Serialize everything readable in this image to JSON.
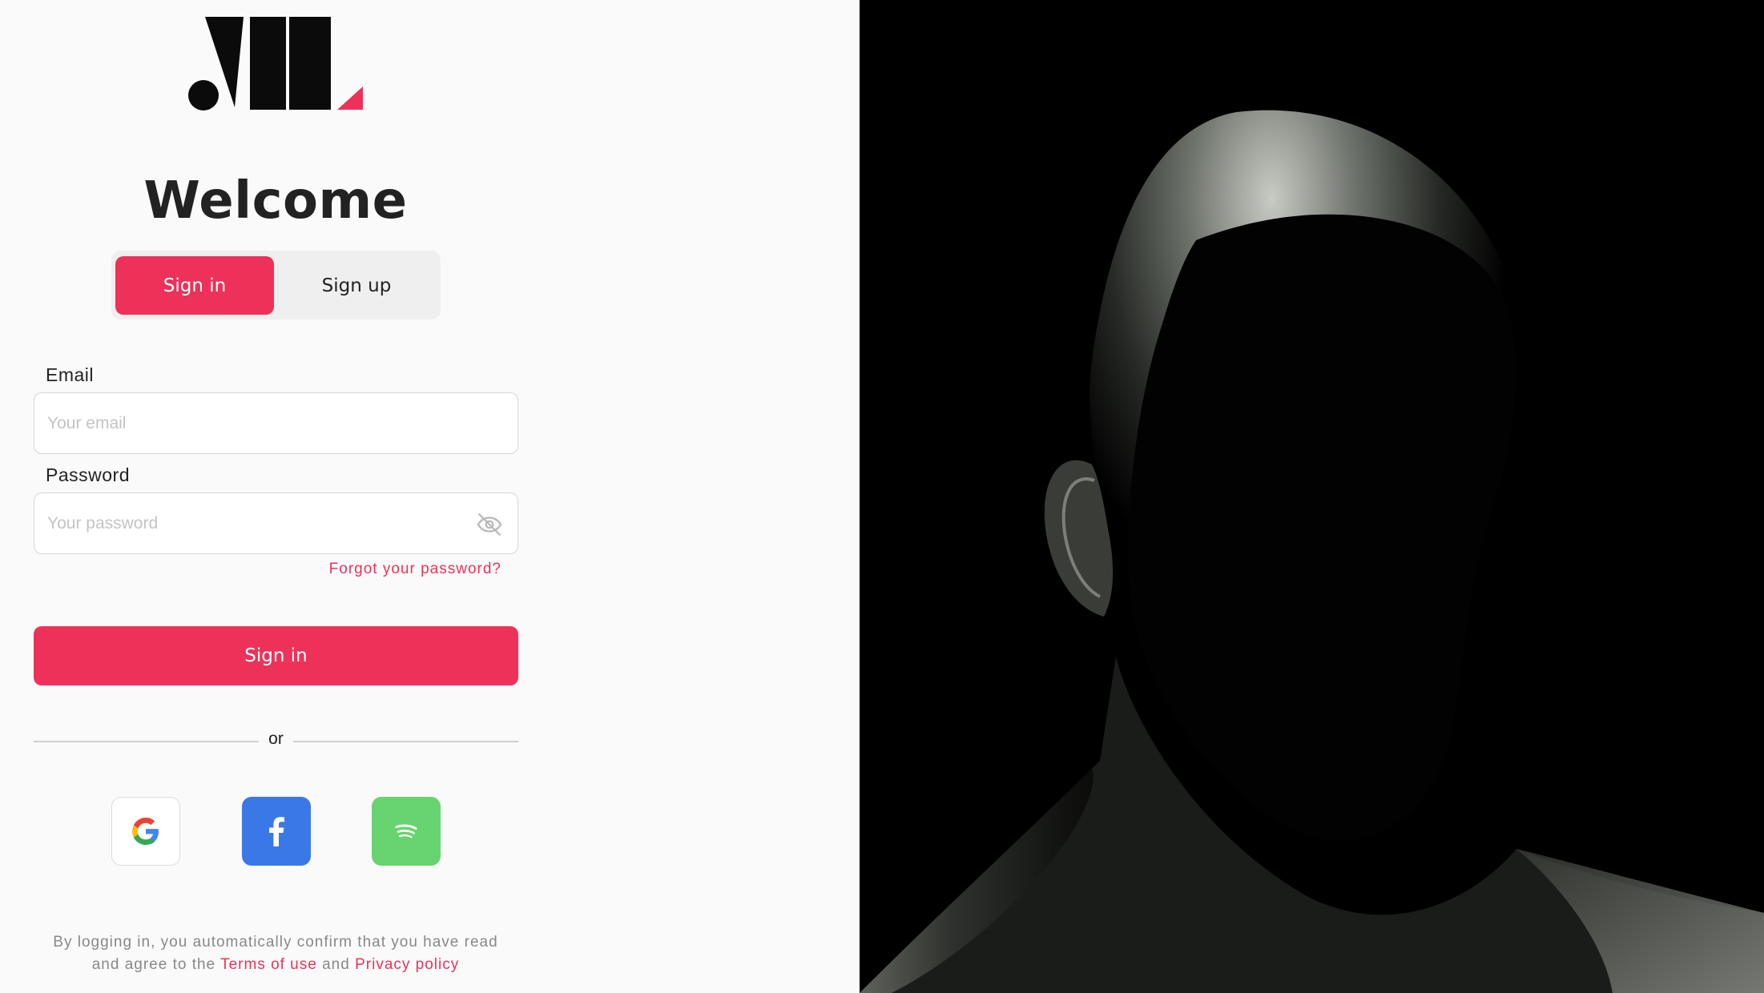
{
  "colors": {
    "accent": "#ee3158",
    "facebook": "#3b78e7",
    "spotify": "#67d46f",
    "hero_background": "#000000"
  },
  "brand": {
    "logo_icon": "ml-logo-icon"
  },
  "heading": "Welcome",
  "tabs": [
    {
      "label": "Sign in",
      "active": true
    },
    {
      "label": "Sign up",
      "active": false
    }
  ],
  "form": {
    "email": {
      "label": "Email",
      "placeholder": "Your email",
      "value": ""
    },
    "password": {
      "label": "Password",
      "placeholder": "Your password",
      "value": "",
      "toggle_icon": "eye-off-icon"
    },
    "forgot_label": "Forgot your password?",
    "submit_label": "Sign in"
  },
  "divider_label": "or",
  "social": [
    {
      "icon": "google-icon"
    },
    {
      "icon": "facebook-icon"
    },
    {
      "icon": "spotify-icon"
    }
  ],
  "legal": {
    "line1": "By logging in, you automatically confirm that you have read",
    "line2_prefix": "and agree to the",
    "terms_label": "Terms of use",
    "conjunction": "and",
    "privacy_label": "Privacy policy"
  },
  "hero": {
    "image": "faceless-head-render"
  }
}
